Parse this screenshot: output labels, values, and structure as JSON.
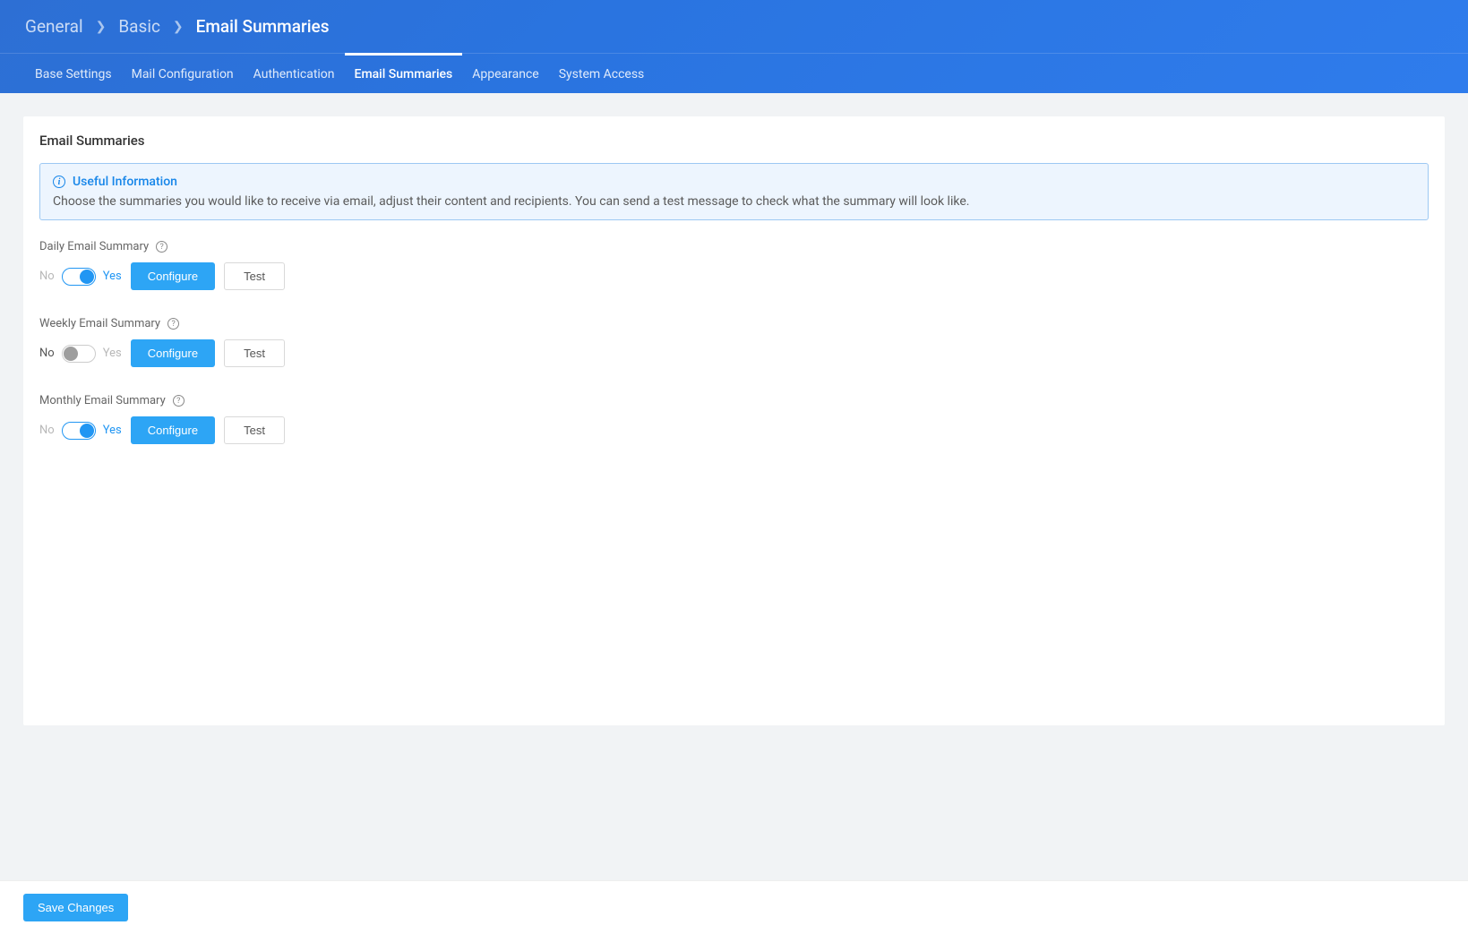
{
  "breadcrumb": {
    "items": [
      {
        "label": "General",
        "active": false
      },
      {
        "label": "Basic",
        "active": false
      },
      {
        "label": "Email Summaries",
        "active": true
      }
    ]
  },
  "tabs": [
    {
      "label": "Base Settings",
      "active": false
    },
    {
      "label": "Mail Configuration",
      "active": false
    },
    {
      "label": "Authentication",
      "active": false
    },
    {
      "label": "Email Summaries",
      "active": true
    },
    {
      "label": "Appearance",
      "active": false
    },
    {
      "label": "System Access",
      "active": false
    }
  ],
  "section": {
    "title": "Email Summaries",
    "info_title": "Useful Information",
    "info_text": "Choose the summaries you would like to receive via email, adjust their content and recipients. You can send a test message to check what the summary will look like."
  },
  "labels": {
    "no": "No",
    "yes": "Yes",
    "configure": "Configure",
    "test": "Test",
    "save": "Save Changes"
  },
  "summaries": [
    {
      "label": "Daily Email Summary",
      "enabled": true
    },
    {
      "label": "Weekly Email Summary",
      "enabled": false
    },
    {
      "label": "Monthly Email Summary",
      "enabled": true
    }
  ]
}
